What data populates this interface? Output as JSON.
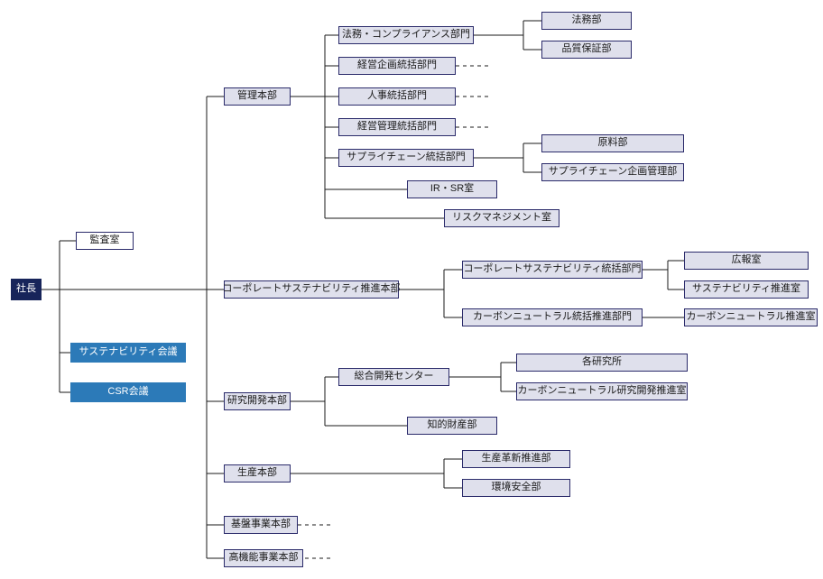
{
  "president": "社長",
  "audit": "監査室",
  "sustain_council": "サステナビリティ会議",
  "csr_council": "CSR会議",
  "hq_admin": "管理本部",
  "hq_corpsus": "コーポレートサステナビリティ推進本部",
  "hq_rd": "研究開発本部",
  "hq_prod": "生産本部",
  "hq_base": "基盤事業本部",
  "hq_hifunc": "高機能事業本部",
  "adm_legal": "法務・コンプライアンス部門",
  "adm_plan": "経営企画統括部門",
  "adm_hr": "人事統括部門",
  "adm_mgmt": "経営管理統括部門",
  "adm_supply": "サプライチェーン統括部門",
  "adm_ir": "IR・SR室",
  "adm_risk": "リスクマネジメント室",
  "legal_dep": "法務部",
  "qa_dep": "品質保証部",
  "raw_dep": "原料部",
  "supplyplan_dep": "サプライチェーン企画管理部",
  "corpsus_div": "コーポレートサステナビリティ統括部門",
  "cn_div": "カーボンニュートラル統括推進部門",
  "pr_dep": "広報室",
  "suspromo_dep": "サステナビリティ推進室",
  "cnpromo_dep": "カーボンニュートラル推進室",
  "rd_center": "総合開発センター",
  "rd_labs": "各研究所",
  "rd_cn": "カーボンニュートラル研究開発推進室",
  "rd_ip": "知的財産部",
  "prod_kakushin": "生産革新推進部",
  "prod_envsafe": "環境安全部"
}
